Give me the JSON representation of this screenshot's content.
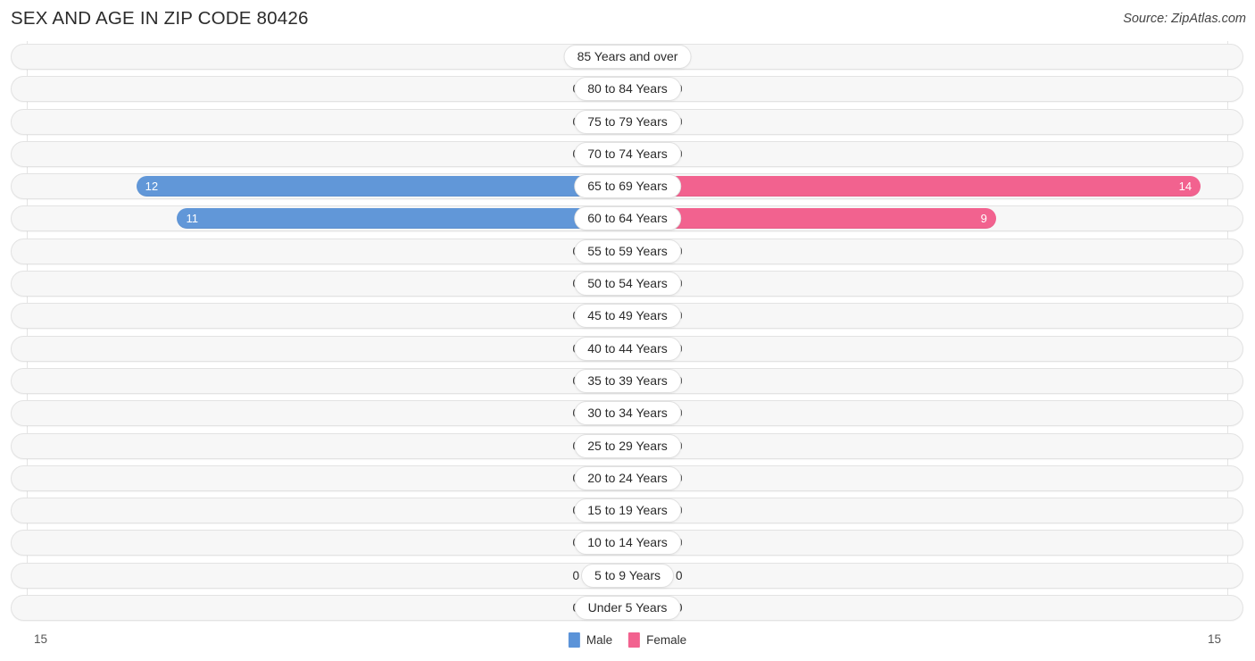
{
  "header": {
    "title": "SEX AND AGE IN ZIP CODE 80426",
    "source": "Source: ZipAtlas.com"
  },
  "legend": {
    "male_label": "Male",
    "female_label": "Female"
  },
  "axis": {
    "left_max_label": "15",
    "right_max_label": "15"
  },
  "colors": {
    "male": "#5b93d8",
    "male_empty": "#a9c8eb",
    "female": "#f2628f",
    "female_empty": "#f4a6c0",
    "track": "#f7f7f7",
    "gridline": "#e4e4e4"
  },
  "chart_data": {
    "type": "bar",
    "subtype": "population-pyramid",
    "title": "SEX AND AGE IN ZIP CODE 80426",
    "xlabel": "",
    "ylabel": "",
    "xlim": [
      15,
      15
    ],
    "grid": true,
    "legend_position": "bottom-center",
    "categories": [
      "85 Years and over",
      "80 to 84 Years",
      "75 to 79 Years",
      "70 to 74 Years",
      "65 to 69 Years",
      "60 to 64 Years",
      "55 to 59 Years",
      "50 to 54 Years",
      "45 to 49 Years",
      "40 to 44 Years",
      "35 to 39 Years",
      "30 to 34 Years",
      "25 to 29 Years",
      "20 to 24 Years",
      "15 to 19 Years",
      "10 to 14 Years",
      "5 to 9 Years",
      "Under 5 Years"
    ],
    "series": [
      {
        "name": "Male",
        "values": [
          0,
          0,
          0,
          0,
          12,
          11,
          0,
          0,
          0,
          0,
          0,
          0,
          0,
          0,
          0,
          0,
          0,
          0
        ]
      },
      {
        "name": "Female",
        "values": [
          0,
          0,
          0,
          0,
          14,
          9,
          0,
          0,
          0,
          0,
          0,
          0,
          0,
          0,
          0,
          0,
          0,
          0
        ]
      }
    ]
  }
}
